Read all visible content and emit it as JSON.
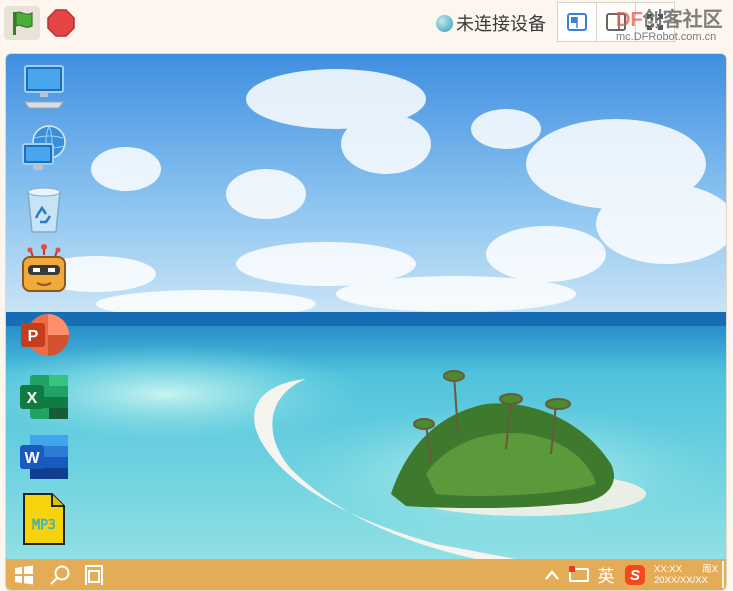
{
  "toolbar": {
    "run_icon": "green-flag-icon",
    "stop_icon": "stop-icon",
    "status_text": "未连接设备",
    "status_color": "#5fb2c6",
    "view_buttons": [
      "small-stage-layout-icon",
      "normal-stage-layout-icon",
      "fullscreen-icon"
    ]
  },
  "watermark": {
    "brand": "DF",
    "name": "创客社区",
    "url": "mc.DFRobot.com.cn"
  },
  "desktop": {
    "wallpaper": "tropical island beach with blue sky and clouds",
    "icons": [
      {
        "name": "computer-icon"
      },
      {
        "name": "network-icon"
      },
      {
        "name": "recycle-bin-icon"
      },
      {
        "name": "robot-app-icon"
      },
      {
        "name": "powerpoint-icon",
        "label": "P"
      },
      {
        "name": "excel-icon",
        "label": "X"
      },
      {
        "name": "word-icon",
        "label": "W"
      },
      {
        "name": "mp3-file-icon",
        "label": "MP3"
      }
    ]
  },
  "taskbar": {
    "color": "#e5ac57",
    "start_icon": "windows-start-icon",
    "search_icon": "search-icon",
    "task_view_icon": "task-view-icon",
    "tray_chevron": "chevron-up-icon",
    "ime_label": "英",
    "ime_app_icon": "sogou-ime-icon",
    "ime_app_letter": "S",
    "time": "XX:XX",
    "weekday": "周X",
    "date": "20XX/XX/XX"
  },
  "colors": {
    "background": "#fdf6ef",
    "flag_green": "#4caf3a",
    "stop_red": "#e54545",
    "accent_brand": "#e05a47"
  }
}
